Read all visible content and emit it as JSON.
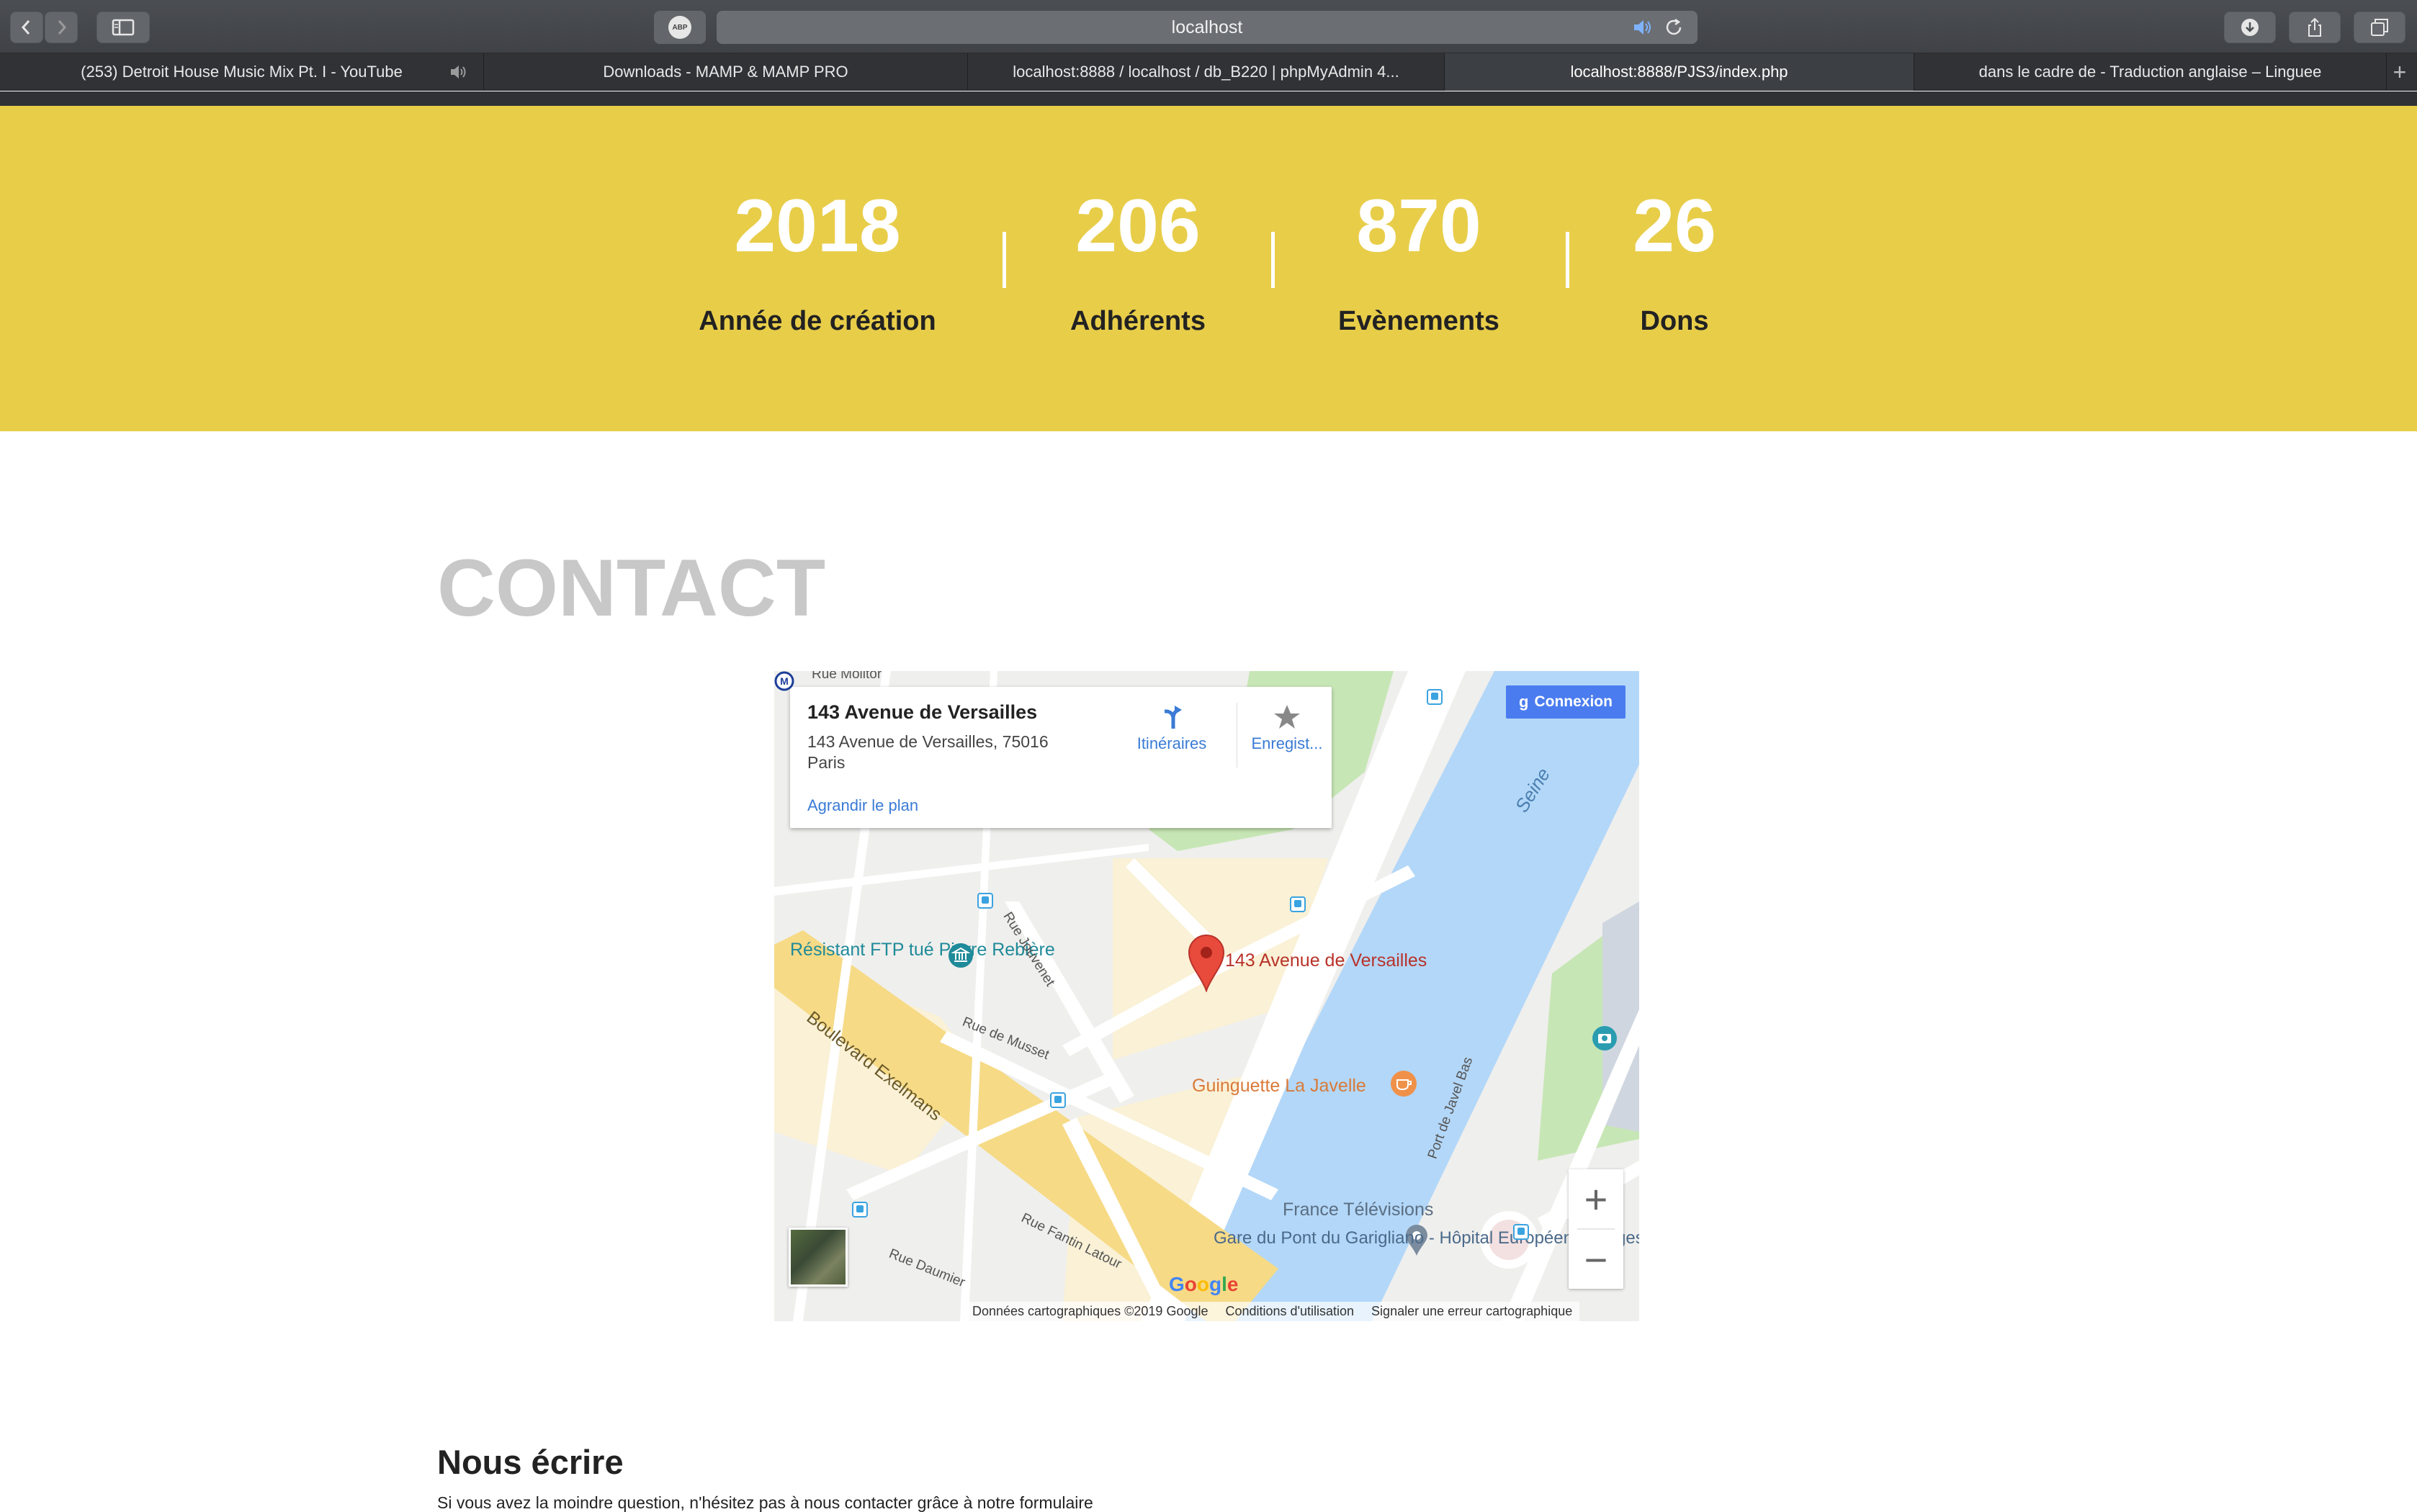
{
  "browser": {
    "url": "localhost",
    "abp_label": "ABP",
    "tabs": [
      {
        "label": "(253) Detroit House Music Mix Pt. I - YouTube",
        "playing_audio": true
      },
      {
        "label": "Downloads - MAMP & MAMP PRO"
      },
      {
        "label": "localhost:8888 / localhost / db_B220 | phpMyAdmin 4..."
      },
      {
        "label": "localhost:8888/PJS3/index.php",
        "active": true
      },
      {
        "label": "dans le cadre de - Traduction anglaise – Linguee"
      }
    ]
  },
  "stats": {
    "background": "#e8cd49",
    "items": [
      {
        "value": "2018",
        "label": "Année de création"
      },
      {
        "value": "206",
        "label": "Adhérents"
      },
      {
        "value": "870",
        "label": "Evènements"
      },
      {
        "value": "26",
        "label": "Dons"
      }
    ]
  },
  "contact": {
    "title": "CONTACT",
    "map": {
      "info_title": "143 Avenue de Versailles",
      "info_address": "143 Avenue de Versailles, 75016 Paris",
      "enlarge_link": "Agrandir le plan",
      "directions_label": "Itinéraires",
      "save_label": "Enregist...",
      "signin_label": "Connexion",
      "marker_label": "143 Avenue de Versailles",
      "poi": {
        "resistant": "Résistant FTP tué Pierre Rebière",
        "guinguette": "Guinguette La Javelle",
        "france_tv": "France Télévisions",
        "gare": "Gare du Pont du Garigliano - Hôpital Européen Georges Pompidou",
        "seine": "Seine"
      },
      "streets": {
        "molitor": "Rue Molitor",
        "jouvenet": "Rue Jouvenet",
        "musset": "Rue de Musset",
        "exelmans": "Boulevard Exelmans",
        "fantin": "Rue Fantin Latour",
        "daumier": "Rue Daumier",
        "javel": "Port de Javel Bas"
      },
      "footer": {
        "data": "Données cartographiques ©2019 Google",
        "terms": "Conditions d'utilisation",
        "report": "Signaler une erreur cartographique"
      },
      "google_letters": [
        "G",
        "o",
        "o",
        "g",
        "l",
        "e"
      ]
    }
  },
  "write": {
    "title": "Nous écrire",
    "text": "Si vous avez la moindre question, n'hésitez pas à nous contacter grâce à notre formulaire"
  }
}
